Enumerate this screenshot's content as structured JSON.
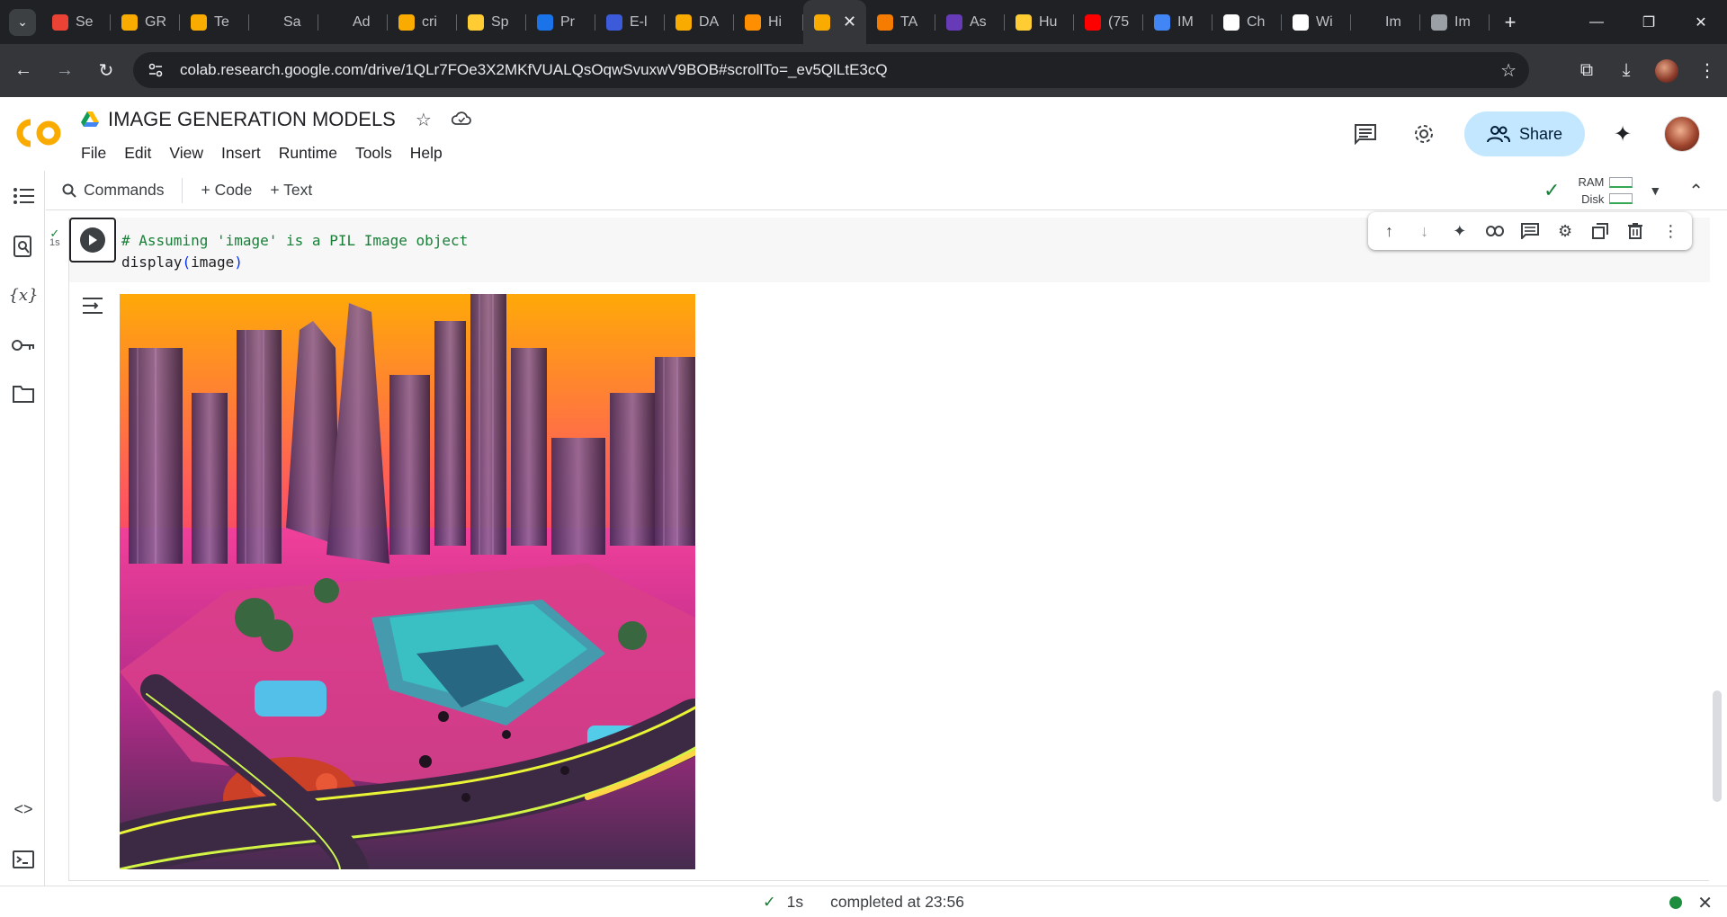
{
  "browser": {
    "tabs": [
      {
        "title": "Se",
        "icon": "gmail-icon",
        "color": "#ea4335"
      },
      {
        "title": "GR",
        "icon": "colab-icon",
        "color": "#f9ab00"
      },
      {
        "title": "Te",
        "icon": "colab-icon",
        "color": "#f9ab00"
      },
      {
        "title": "Sa",
        "icon": "github-icon",
        "color": "#202124"
      },
      {
        "title": "Ad",
        "icon": "github-icon",
        "color": "#202124"
      },
      {
        "title": "cri",
        "icon": "colab-icon",
        "color": "#f9ab00"
      },
      {
        "title": "Sp",
        "icon": "huggingface-icon",
        "color": "#ffcc33"
      },
      {
        "title": "Pr",
        "icon": "c-icon",
        "color": "#1a73e8"
      },
      {
        "title": "E-l",
        "icon": "tds-icon",
        "color": "#3b5bdb"
      },
      {
        "title": "DA",
        "icon": "colab-icon",
        "color": "#f9ab00"
      },
      {
        "title": "Hi",
        "icon": "tensorflow-icon",
        "color": "#ff8f00"
      },
      {
        "title": "",
        "icon": "colab-icon",
        "color": "#f9ab00",
        "active": true
      },
      {
        "title": "TA",
        "icon": "person-icon",
        "color": "#f57c00"
      },
      {
        "title": "As",
        "icon": "list-icon",
        "color": "#673ab7"
      },
      {
        "title": "Hu",
        "icon": "huggingface-icon",
        "color": "#ffcc33"
      },
      {
        "title": "(75",
        "icon": "youtube-icon",
        "color": "#ff0000"
      },
      {
        "title": "IM",
        "icon": "google-icon",
        "color": "#4285f4"
      },
      {
        "title": "Ch",
        "icon": "openai-icon",
        "color": "#ffffff"
      },
      {
        "title": "Wi",
        "icon": "openai-icon",
        "color": "#ffffff"
      },
      {
        "title": "Im",
        "icon": "github-icon",
        "color": "#202124"
      },
      {
        "title": "Im",
        "icon": "globe-icon",
        "color": "#9aa0a6"
      }
    ],
    "url": "colab.research.google.com/drive/1QLr7FOe3X2MKfVUALQsOqwSvuxwV9BOB#scrollTo=_ev5QlLtE3cQ"
  },
  "notebook": {
    "title": "IMAGE GENERATION MODELS",
    "menu": [
      "File",
      "Edit",
      "View",
      "Insert",
      "Runtime",
      "Tools",
      "Help"
    ],
    "share_label": "Share"
  },
  "toolbar": {
    "commands_label": "Commands",
    "code_label": "+ Code",
    "text_label": "+ Text",
    "ram_label": "RAM",
    "disk_label": "Disk"
  },
  "cell": {
    "exec_time": "1s",
    "code_comment": "# Assuming 'image' is a PIL Image object",
    "code_fn": "display",
    "code_open": "(",
    "code_arg": "image",
    "code_close": ")"
  },
  "status": {
    "time": "1s",
    "message": "completed at 23:56"
  },
  "colors": {
    "accent": "#c2e7ff",
    "ok": "#188038",
    "colab_orange": "#f9ab00"
  }
}
